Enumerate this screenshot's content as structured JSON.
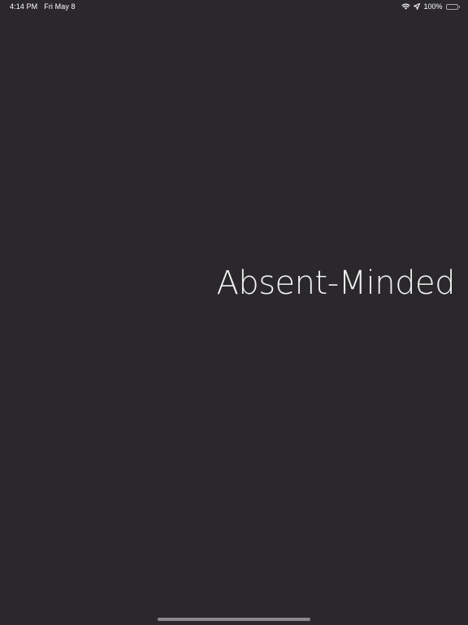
{
  "status_bar": {
    "time": "4:14 PM",
    "date": "Fri May 8",
    "battery_percent": "100%",
    "icons": [
      "wifi-icon",
      "location-icon",
      "battery-icon"
    ]
  },
  "main": {
    "title": "Absent-Minded"
  },
  "colors": {
    "background": "#2a282b",
    "text": "#ffffff",
    "home_indicator": "#8a888c"
  }
}
